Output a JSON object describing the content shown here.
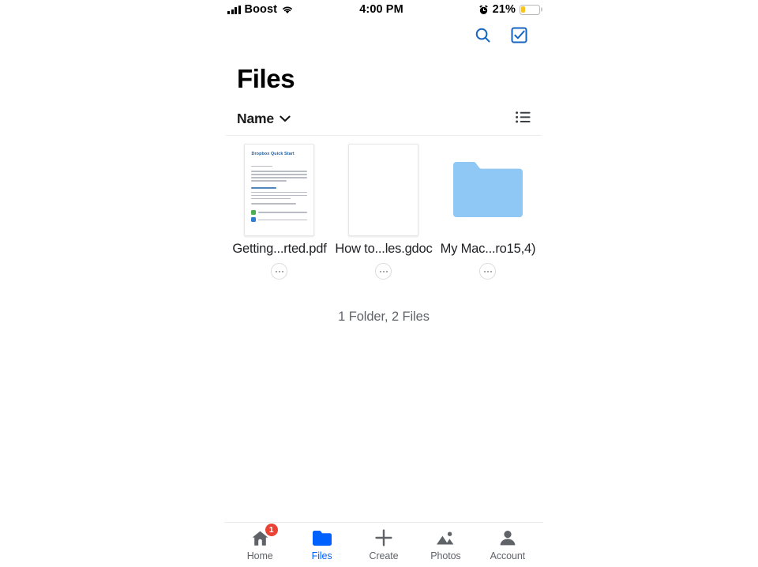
{
  "status_bar": {
    "carrier": "Boost",
    "time": "4:00 PM",
    "battery_percent": "21%",
    "battery_level": 21,
    "signal_icon": "signal-bars-icon",
    "wifi_icon": "wifi-icon",
    "alarm_icon": "alarm-clock-icon",
    "battery_color": "#f7c325"
  },
  "nav": {
    "search_icon": "search-icon",
    "select_icon": "checkbox-check-icon",
    "accent_color": "#1564c0"
  },
  "header": {
    "title": "Files"
  },
  "sort_row": {
    "sort_label": "Name",
    "chevron_icon": "chevron-down-icon",
    "view_toggle_icon": "list-view-icon"
  },
  "files": [
    {
      "name": "Getting...rted.pdf",
      "type": "pdf",
      "thumb_title": "Dropbox Quick Start",
      "more_label": "more-options"
    },
    {
      "name": "How to...les.gdoc",
      "type": "gdoc",
      "thumb_title": "",
      "more_label": "more-options"
    },
    {
      "name": "My Mac...ro15,4)",
      "type": "folder",
      "thumb_title": "",
      "more_label": "more-options",
      "folder_color": "#90c8f5"
    }
  ],
  "summary": {
    "count_text": "1 Folder, 2 Files"
  },
  "tab_bar": {
    "active_color": "#0061ff",
    "inactive_color": "#5f6368",
    "badge_color": "#ea4335",
    "items": [
      {
        "label": "Home",
        "icon": "home-icon",
        "badge": "1",
        "active": false
      },
      {
        "label": "Files",
        "icon": "folder-icon",
        "badge": null,
        "active": true
      },
      {
        "label": "Create",
        "icon": "plus-icon",
        "badge": null,
        "active": false
      },
      {
        "label": "Photos",
        "icon": "photos-icon",
        "badge": null,
        "active": false
      },
      {
        "label": "Account",
        "icon": "person-icon",
        "badge": null,
        "active": false
      }
    ]
  }
}
